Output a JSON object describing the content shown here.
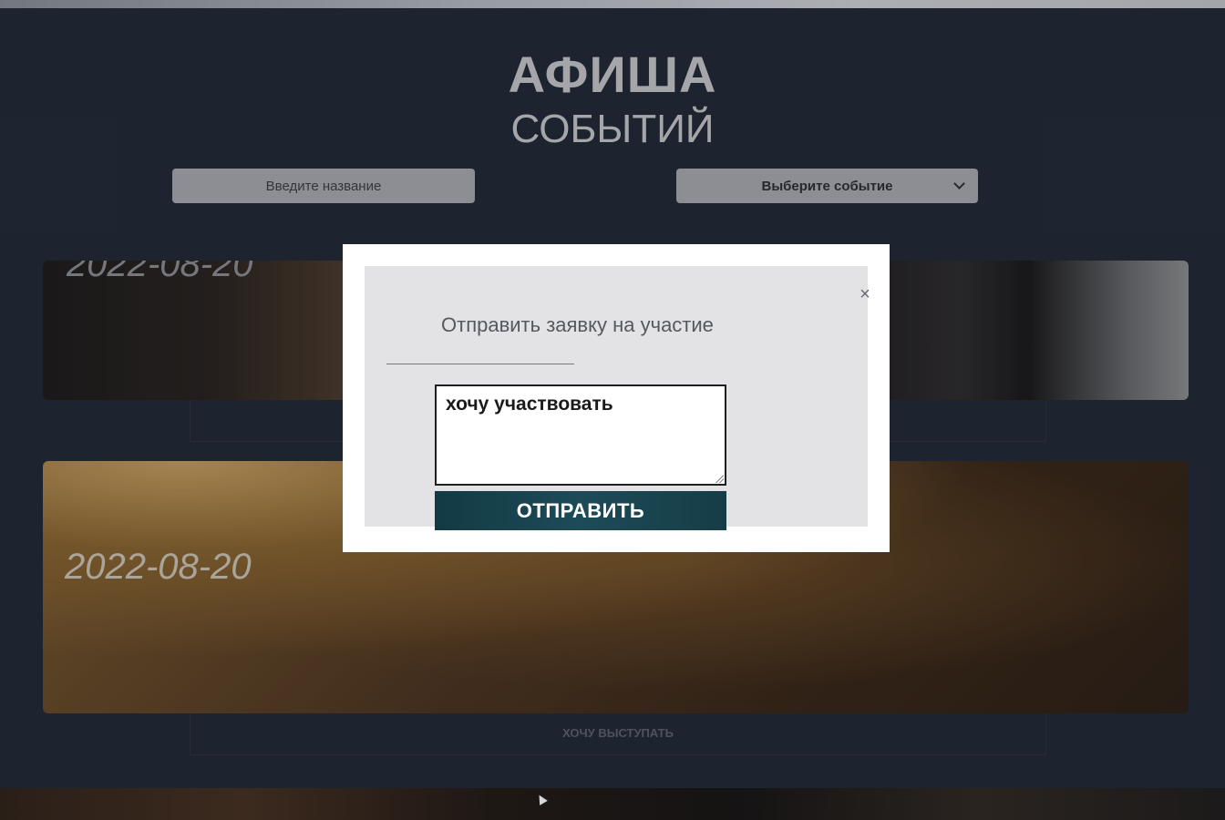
{
  "header": {
    "title": "АФИША",
    "subtitle": "СОБЫТИЙ"
  },
  "filters": {
    "search_placeholder": "Введите название",
    "event_select_value": "Выберите событие"
  },
  "events": [
    {
      "date": "2022-08-20"
    },
    {
      "date": "2022-08-20",
      "action_label": "ХОЧУ ВЫСТУПАТЬ"
    }
  ],
  "modal": {
    "title": "Отправить заявку на участие",
    "close_symbol": "×",
    "message_value": "хочу участвовать",
    "submit_label": "ОТПРАВИТЬ"
  },
  "colors": {
    "page_bg": "#232a36",
    "submit_bg": "#1d4b57",
    "input_bg": "#a9abb0"
  }
}
